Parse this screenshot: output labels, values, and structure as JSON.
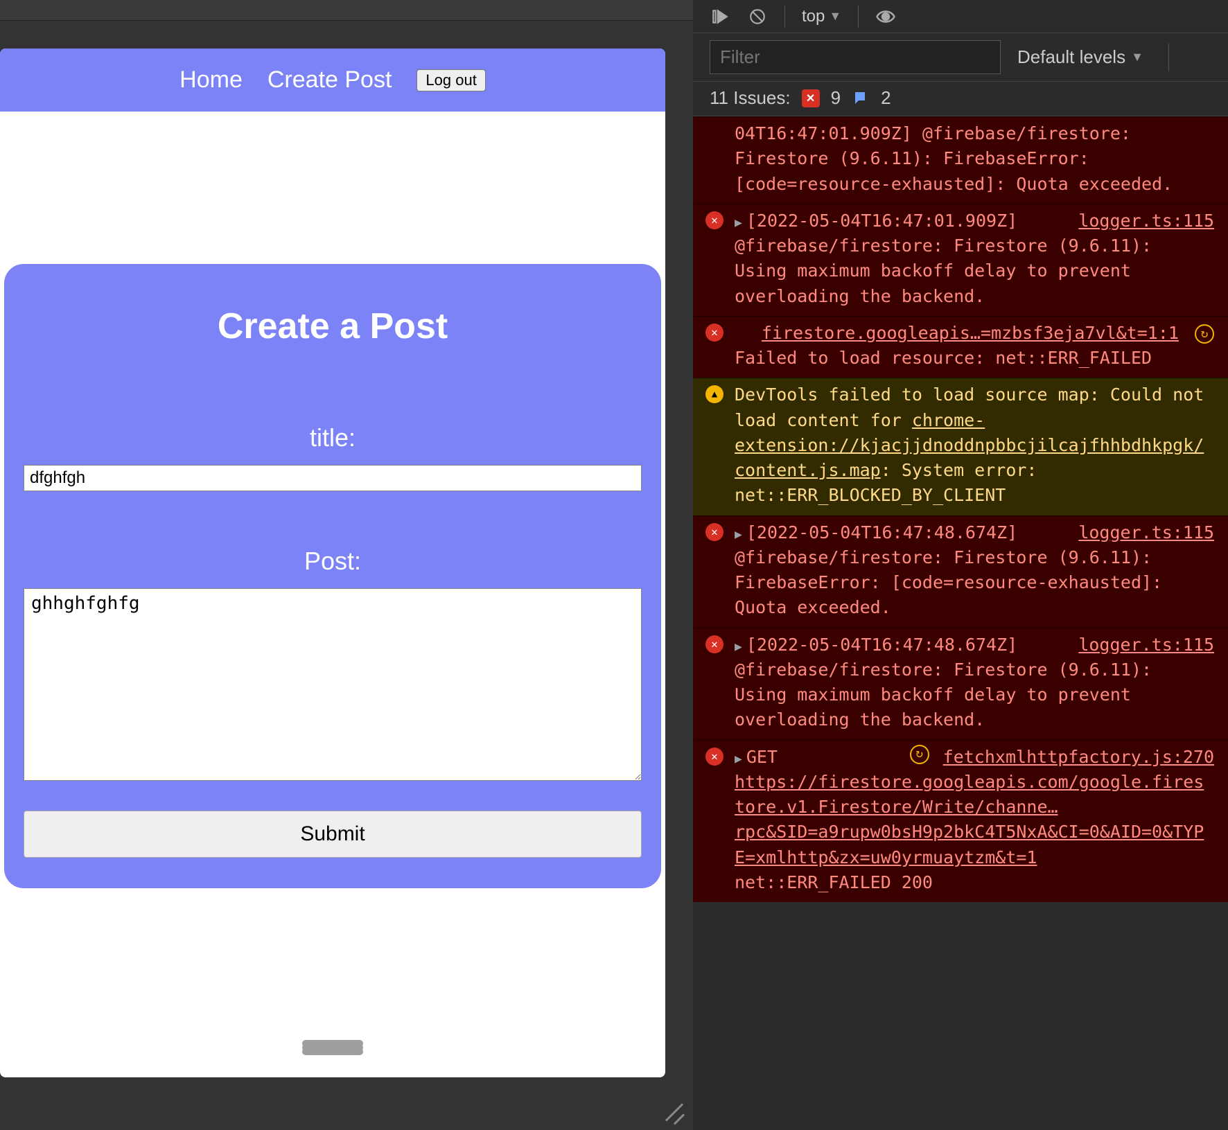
{
  "app": {
    "nav": {
      "home": "Home",
      "create": "Create Post",
      "logout": "Log out"
    },
    "card": {
      "heading": "Create a Post",
      "title_label": "title:",
      "title_value": "dfghfgh",
      "post_label": "Post:",
      "post_value": "ghhghfghfg",
      "submit": "Submit"
    }
  },
  "devtools": {
    "context": "top",
    "filter_placeholder": "Filter",
    "levels": "Default levels",
    "issues_label": "11 Issues:",
    "err_count": "9",
    "info_count": "2",
    "messages": [
      {
        "type": "err",
        "text": "04T16:47:01.909Z]  @firebase/firestore: Firestore (9.6.11): FirebaseError: [code=resource-exhausted]: Quota exceeded.",
        "source": ""
      },
      {
        "type": "err",
        "arrow": true,
        "text": "[2022-05-04T16:47:01.909Z]  @firebase/firestore: Firestore (9.6.11): Using maximum backoff delay to prevent overloading the backend.",
        "source": "logger.ts:115"
      },
      {
        "type": "err",
        "text_pre": "",
        "link": "firestore.googleapis…=mzbsf3eja7vl&t=1:1",
        "reload": true,
        "text": "Failed to load resource: net::ERR_FAILED"
      },
      {
        "type": "warn",
        "text_pre": "DevTools failed to load source map: Could not load content for ",
        "link": "chrome-extension://kjacjjdnoddnpbbcjilcajfhhbdhkpgk/content.js.map",
        "text_post": ": System error: net::ERR_BLOCKED_BY_CLIENT"
      },
      {
        "type": "err",
        "arrow": true,
        "text": "[2022-05-04T16:47:48.674Z]  @firebase/firestore: Firestore (9.6.11): FirebaseError: [code=resource-exhausted]: Quota exceeded.",
        "source": "logger.ts:115"
      },
      {
        "type": "err",
        "arrow": true,
        "text": "[2022-05-04T16:47:48.674Z]  @firebase/firestore: Firestore (9.6.11): Using maximum backoff delay to prevent overloading the backend.",
        "source": "logger.ts:115"
      },
      {
        "type": "err",
        "arrow": true,
        "method": "GET",
        "link": "https://firestore.googleapis.com/google.firestore.v1.Firestore/Write/channe…rpc&SID=a9rupw0bsH9p2bkC4T5NxA&CI=0&AID=0&TYPE=xmlhttp&zx=uw0yrmuaytzm&t=1",
        "source": "fetchxmlhttpfactory.js:270",
        "reload": true,
        "text_post": "net::ERR_FAILED 200"
      }
    ]
  }
}
